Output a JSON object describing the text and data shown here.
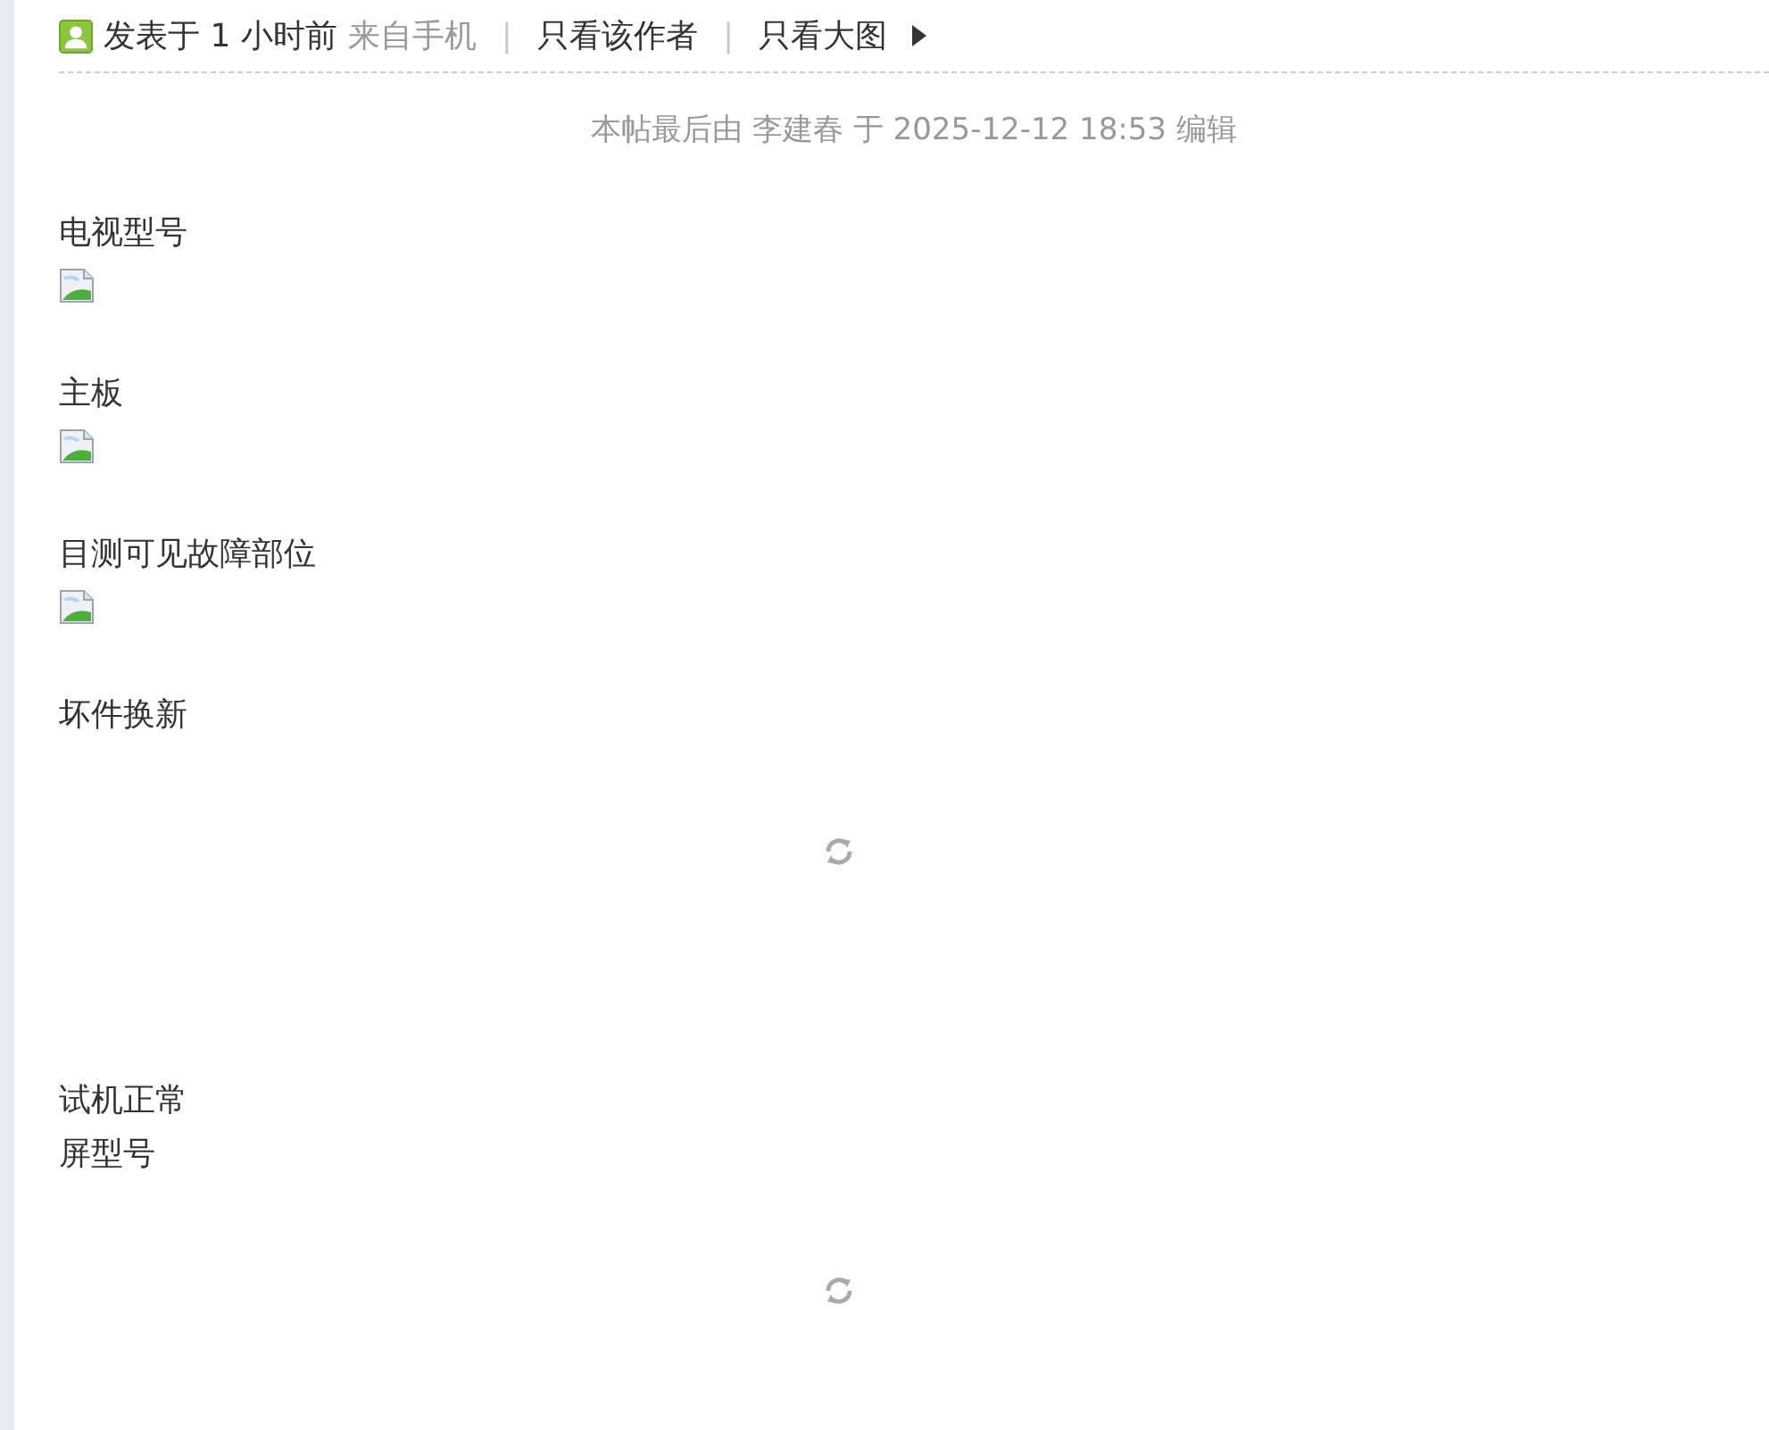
{
  "post_header": {
    "posted": "发表于 1 小时前",
    "source": "来自手机",
    "links": [
      {
        "separator": "|",
        "label": "只看该作者"
      },
      {
        "separator": "|",
        "label": "只看大图"
      }
    ]
  },
  "edit_note": "本帖最后由 李建春 于 2025-12-12 18:53 编辑",
  "content": [
    {
      "kind": "text",
      "text": "电视型号"
    },
    {
      "kind": "image"
    },
    {
      "kind": "text",
      "text": "主板"
    },
    {
      "kind": "image"
    },
    {
      "kind": "text",
      "text": "目测可见故障部位"
    },
    {
      "kind": "image"
    },
    {
      "kind": "text",
      "text": "坏件换新"
    },
    {
      "kind": "loading"
    },
    {
      "kind": "text",
      "text": "试机正常"
    },
    {
      "kind": "text",
      "text": "屏型号"
    },
    {
      "kind": "loading"
    }
  ]
}
